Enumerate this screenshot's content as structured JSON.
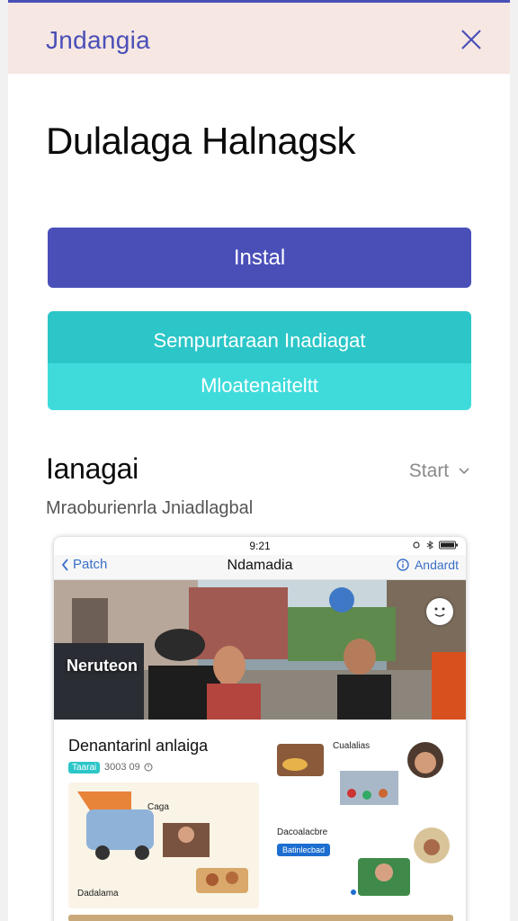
{
  "header": {
    "app_name": "Jndangia",
    "close_icon": "close-icon"
  },
  "page": {
    "title": "Dulalaga Halnagsk"
  },
  "buttons": {
    "install_label": "Instal",
    "secondary_label": "Sempurtaraan Inadiagat",
    "secondary_sub_label": "Mloatenaiteltt"
  },
  "section": {
    "title": "Ianagai",
    "start_label": "Start",
    "subtitle": "Mraoburienrla Jniadlagbal"
  },
  "preview": {
    "status_time": "9:21",
    "nav_back": "Patch",
    "nav_title": "Ndamadia",
    "nav_action": "Andardt",
    "photo_label": "Neruteon",
    "card_title": "Denantarinl anlaiga",
    "tag": "Taarai",
    "meta": "3003 09",
    "card_a_label_top": "Caga",
    "card_a_label_bottom": "Dadalama",
    "card_b_label": "Cualalias",
    "card_c_label": "Dacoalacbre",
    "card_c_button": "Batinlecbad"
  },
  "colors": {
    "accent": "#4a4fb8",
    "teal": "#2cc6c8",
    "teal_light": "#3fdbdb",
    "header_bg": "#f6e7e2"
  }
}
